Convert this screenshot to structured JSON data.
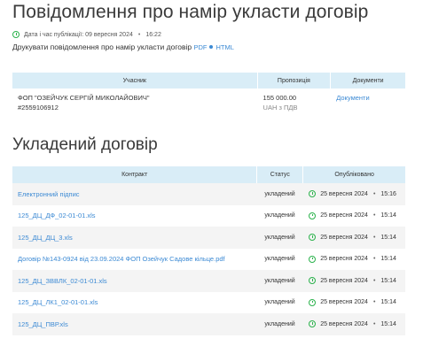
{
  "notice": {
    "title": "Повідомлення про намір укласти договір",
    "pub_label": "Дата і час публікації: 09 вересня 2024",
    "pub_time": "16:22",
    "print_label": "Друкувати повідомлення про намір укласти договір",
    "pdf_link": "PDF",
    "html_link": "HTML"
  },
  "participants_table": {
    "headers": [
      "Учасник",
      "Пропозиція",
      "Документи"
    ],
    "rows": [
      {
        "participant": "ФОП \"ОЗЕЙЧУК СЕРГІЙ МИКОЛАЙОВИЧ\"",
        "code": "#2559106912",
        "amount": "155 000.00",
        "currency": "UAH з ПДВ",
        "docs_link": "Документи"
      }
    ]
  },
  "contract": {
    "title": "Укладений договір",
    "headers": [
      "Контракт",
      "Статус",
      "Опубліковано"
    ],
    "rows": [
      {
        "name": "Електронний підпис",
        "status": "укладений",
        "date": "25 вересня 2024",
        "time": "15:16"
      },
      {
        "name": "125_ДЦ_ДФ_02-01-01.xls",
        "status": "укладений",
        "date": "25 вересня 2024",
        "time": "15:14"
      },
      {
        "name": "125_ДЦ_ДЦ_3.xls",
        "status": "укладений",
        "date": "25 вересня 2024",
        "time": "15:14"
      },
      {
        "name": "Договір №143-0924 від 23.09.2024 ФОП Озейчук Садове кільце.pdf",
        "status": "укладений",
        "date": "25 вересня 2024",
        "time": "15:14"
      },
      {
        "name": "125_ДЦ_ЗВВЛК_02-01-01.xls",
        "status": "укладений",
        "date": "25 вересня 2024",
        "time": "15:14"
      },
      {
        "name": "125_ДЦ_ЛК1_02-01-01.xls",
        "status": "укладений",
        "date": "25 вересня 2024",
        "time": "15:14"
      },
      {
        "name": "125_ДЦ_ПВР.xls",
        "status": "укладений",
        "date": "25 вересня 2024",
        "time": "15:14"
      }
    ]
  },
  "colors": {
    "accent_link": "#3c8ad4",
    "header_bg": "#d9edf7",
    "clock_icon": "#2bb24c"
  },
  "icons": {
    "clock": "clock-icon",
    "separator": "dot-separator-icon"
  }
}
